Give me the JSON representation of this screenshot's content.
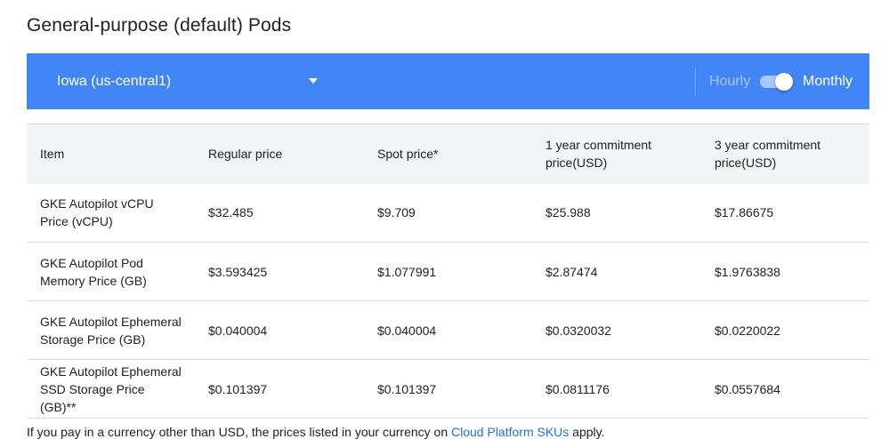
{
  "page": {
    "title": "General-purpose (default) Pods"
  },
  "toolbar": {
    "region": "Iowa (us-central1)",
    "hourly_label": "Hourly",
    "monthly_label": "Monthly",
    "toggle_state": "Monthly",
    "accent_color": "#4285f4"
  },
  "table": {
    "headers": [
      "Item",
      "Regular price",
      "Spot price*",
      "1 year commitment price(USD)",
      "3 year commitment price(USD)"
    ],
    "rows": [
      [
        "GKE Autopilot vCPU Price (vCPU)",
        "$32.485",
        "$9.709",
        "$25.988",
        "$17.86675"
      ],
      [
        "GKE Autopilot Pod Memory Price (GB)",
        "$3.593425",
        "$1.077991",
        "$2.87474",
        "$1.9763838"
      ],
      [
        "GKE Autopilot Ephemeral Storage Price (GB)",
        "$0.040004",
        "$0.040004",
        "$0.0320032",
        "$0.0220022"
      ],
      [
        "GKE Autopilot Ephemeral SSD Storage Price (GB)**",
        "$0.101397",
        "$0.101397",
        "$0.0811176",
        "$0.0557684"
      ]
    ]
  },
  "footnote": {
    "prefix": "If you pay in a currency other than USD, the prices listed in your currency on ",
    "link": "Cloud Platform SKUs",
    "suffix": " apply."
  }
}
